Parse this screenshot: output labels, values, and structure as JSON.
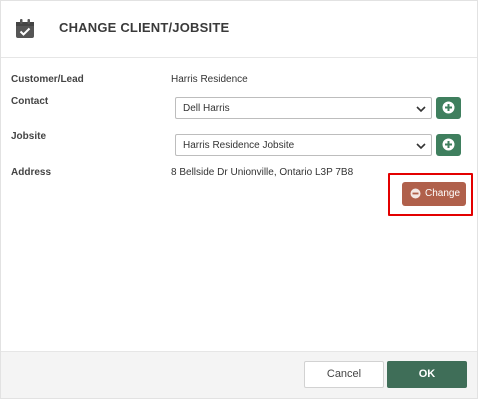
{
  "header": {
    "title": "CHANGE CLIENT/JOBSITE",
    "icon": "calendar-check-icon"
  },
  "form": {
    "customer_label": "Customer/Lead",
    "customer_value": "Harris Residence",
    "contact_label": "Contact",
    "contact_value": "Dell Harris",
    "jobsite_label": "Jobsite",
    "jobsite_value": "Harris Residence Jobsite",
    "address_label": "Address",
    "address_value": "8 Bellside Dr Unionville, Ontario L3P 7B8",
    "change_label": "Change"
  },
  "footer": {
    "cancel_label": "Cancel",
    "ok_label": "OK"
  },
  "colors": {
    "add_button": "#3f7f5e",
    "change_button": "#b0604b",
    "highlight": "#e30000",
    "ok_button": "#3f6e58"
  }
}
